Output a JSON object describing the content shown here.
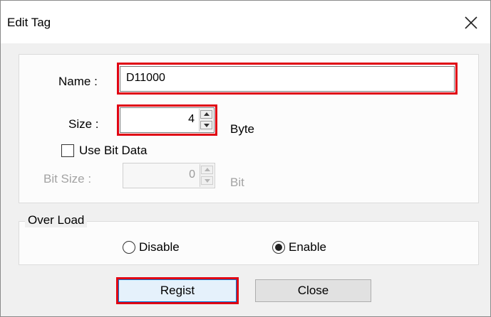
{
  "window": {
    "title": "Edit Tag"
  },
  "main": {
    "name_label": "Name :",
    "name_value": "D11000",
    "size_label": "Size :",
    "size_value": "4",
    "size_unit": "Byte",
    "use_bit_label": "Use Bit Data",
    "use_bit_checked": false,
    "bit_size_label": "Bit Size :",
    "bit_size_value": "0",
    "bit_unit": "Bit"
  },
  "overload": {
    "legend": "Over Load",
    "disable_label": "Disable",
    "enable_label": "Enable",
    "selected": "Enable"
  },
  "buttons": {
    "regist": "Regist",
    "close": "Close"
  },
  "colors": {
    "highlight": "#e00012",
    "focus": "#0078d7"
  }
}
